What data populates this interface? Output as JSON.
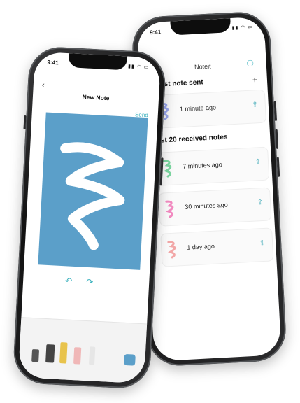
{
  "back_screen": {
    "status_time": "9:41",
    "app_title": "Noteit",
    "latest_section": "Latest note sent",
    "received_section": "Last 20 received notes",
    "add_label": "+",
    "notes": [
      {
        "time": "1 minute ago",
        "color": "#9aa8f0"
      },
      {
        "time": "7 minutes ago",
        "color": "#7bd6a0"
      },
      {
        "time": "30 minutes ago",
        "color": "#f28bc1"
      },
      {
        "time": "1 day ago",
        "color": "#f2a7a7"
      }
    ]
  },
  "front_screen": {
    "status_time": "9:41",
    "title": "New Note",
    "send_label": "Send",
    "canvas_color": "#5b9fc9",
    "stroke_color": "#ffffff",
    "undo_icon": "undo-arrow",
    "redo_icon": "redo-arrow"
  },
  "colors": {
    "accent": "#3fb3bf"
  }
}
